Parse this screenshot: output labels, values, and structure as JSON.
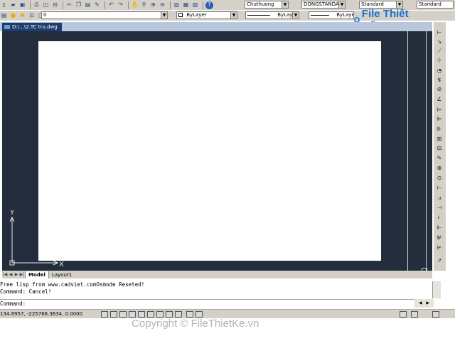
{
  "toolbar": {
    "row1_icons": [
      "new-icon",
      "open-icon",
      "save-icon",
      "print-icon",
      "plot-preview-icon",
      "publish-icon",
      "cut-icon",
      "copy-icon",
      "paste-icon",
      "match-properties-icon",
      "undo-icon",
      "redo-icon",
      "pan-icon",
      "zoom-realtime-icon",
      "zoom-window-icon",
      "zoom-previous-icon",
      "properties-icon",
      "design-center-icon",
      "tool-palettes-icon",
      "help-icon"
    ],
    "text_style": "Chuthuong",
    "dim_style": "DONGSTANDA",
    "table_style": "Standard",
    "multileader_style": "Standard"
  },
  "layers": {
    "current_layer": "0",
    "color": "ByLayer",
    "linetype": "ByLayer",
    "lineweight": "ByLayer"
  },
  "logo": {
    "text": "File Thiết Kế.vn"
  },
  "document": {
    "tab_title": "D:\\...\\2.TC tru.dwg"
  },
  "canvas": {
    "background": "#232d3b",
    "paper": "#ffffff",
    "ucs_y": "Y",
    "ucs_x": "X"
  },
  "layout_tabs": {
    "items": [
      "Model",
      "Layout1"
    ],
    "active": "Model"
  },
  "command": {
    "history": [
      "Free lisp from www.cadviet.comOsmode Reseted!",
      "Command: Cancel!"
    ],
    "prompt": "Command:"
  },
  "status": {
    "coordinates": "134.8957, -225766.3634, 0.0000"
  },
  "watermark": {
    "text": "Copyright © FileThietKe.vn"
  }
}
